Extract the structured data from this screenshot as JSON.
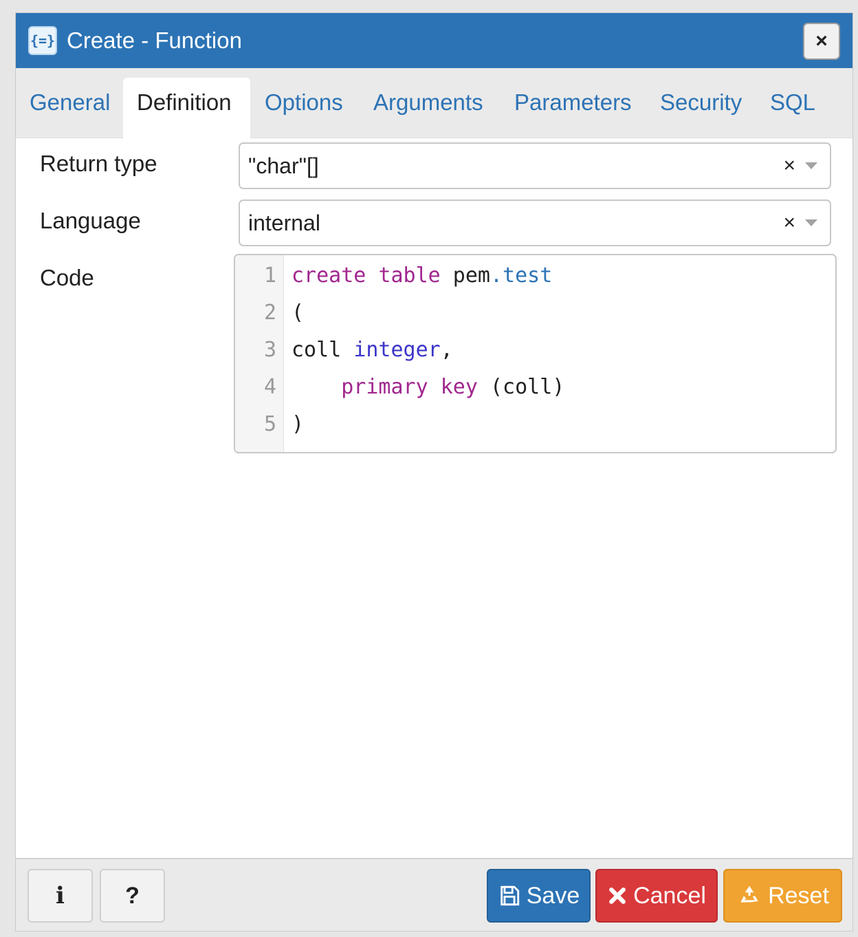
{
  "dialog": {
    "title": "Create - Function",
    "title_icon": "{=}",
    "close_label": "×"
  },
  "tabs": [
    {
      "label": "General",
      "active": false
    },
    {
      "label": "Definition",
      "active": true
    },
    {
      "label": "Options",
      "active": false
    },
    {
      "label": "Arguments",
      "active": false
    },
    {
      "label": "Parameters",
      "active": false
    },
    {
      "label": "Security",
      "active": false
    },
    {
      "label": "SQL",
      "active": false
    }
  ],
  "form": {
    "return_type": {
      "label": "Return type",
      "value": "\"char\"[]",
      "clear": "×"
    },
    "language": {
      "label": "Language",
      "value": "internal",
      "clear": "×"
    },
    "code": {
      "label": "Code",
      "lines": [
        {
          "num": "1",
          "parts": [
            {
              "t": "create",
              "c": "kw"
            },
            {
              "t": " "
            },
            {
              "t": "table",
              "c": "kw"
            },
            {
              "t": " pem"
            },
            {
              "t": ".test",
              "c": "prop"
            }
          ]
        },
        {
          "num": "2",
          "parts": [
            {
              "t": "("
            }
          ]
        },
        {
          "num": "3",
          "parts": [
            {
              "t": "coll "
            },
            {
              "t": "integer",
              "c": "ty"
            },
            {
              "t": ","
            }
          ]
        },
        {
          "num": "4",
          "parts": [
            {
              "t": "    "
            },
            {
              "t": "primary",
              "c": "kw"
            },
            {
              "t": " "
            },
            {
              "t": "key",
              "c": "kw"
            },
            {
              "t": " (coll)"
            }
          ]
        },
        {
          "num": "5",
          "parts": [
            {
              "t": ")"
            }
          ]
        }
      ]
    }
  },
  "footer": {
    "info_label": "i",
    "help_label": "?",
    "save_label": "Save",
    "cancel_label": "Cancel",
    "reset_label": "Reset"
  },
  "colors": {
    "titlebar": "#2c73b5",
    "save": "#2c73b5",
    "cancel": "#d9393b",
    "reset": "#f0a330",
    "keyword": "#a0278f",
    "type": "#3b35c9"
  },
  "icons": {
    "title": "function-icon",
    "close": "close-icon",
    "save": "floppy-disk-icon",
    "cancel": "x-icon",
    "reset": "recycle-icon"
  }
}
